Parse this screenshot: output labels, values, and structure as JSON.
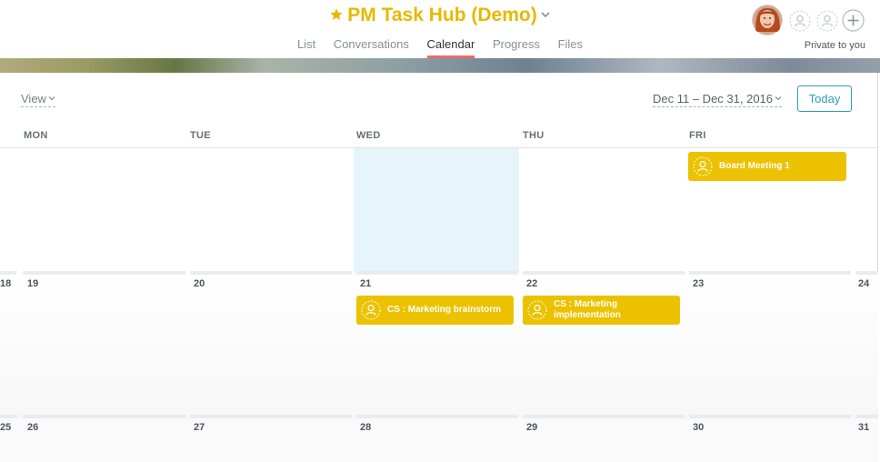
{
  "project": {
    "title": "PM Task Hub (Demo)",
    "starred": true,
    "accent_color": "#e8b800",
    "privacy": "Private to you"
  },
  "nav": {
    "tabs": [
      "List",
      "Conversations",
      "Calendar",
      "Progress",
      "Files"
    ],
    "active_tab": "Calendar",
    "active_underline_color": "#f06a6a"
  },
  "toolbar": {
    "view_label": "View",
    "date_range": "Dec 11 – Dec 31, 2016",
    "today_label": "Today",
    "today_color": "#2b9eb3"
  },
  "calendar": {
    "weekdays": [
      "MON",
      "TUE",
      "WED",
      "THU",
      "FRI"
    ],
    "today_highlight_color": "#e6f5fb",
    "week2_days": [
      "18",
      "19",
      "20",
      "21",
      "22",
      "23",
      "24"
    ],
    "week3_days": [
      "25",
      "26",
      "27",
      "28",
      "29",
      "30",
      "31"
    ],
    "tasks": [
      {
        "label": "Board Meeting 1",
        "day": "FRI",
        "color": "#ecc200",
        "icon": "unassigned-user-icon"
      },
      {
        "label": "CS : Marketing brainstorm",
        "day": "21",
        "color": "#ecc200",
        "icon": "unassigned-user-icon"
      },
      {
        "label": "CS : Marketing implementation",
        "day": "22",
        "color": "#ecc200",
        "icon": "unassigned-user-icon"
      }
    ]
  }
}
